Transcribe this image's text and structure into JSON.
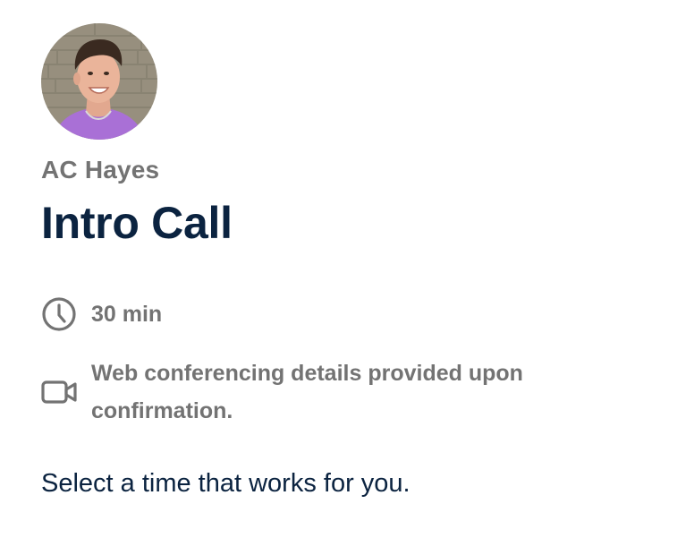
{
  "host": {
    "avatar_icon": "host-photo",
    "name": "AC Hayes"
  },
  "event": {
    "title": "Intro Call",
    "duration_icon": "clock-icon",
    "duration": "30 min",
    "location_icon": "video-camera-icon",
    "location": "Web conferencing details provided upon confirmation."
  },
  "instruction": "Select a time that works for you.",
  "colors": {
    "title": "#0b2340",
    "muted_text": "#737373",
    "avatar_shirt": "#a970d6"
  }
}
